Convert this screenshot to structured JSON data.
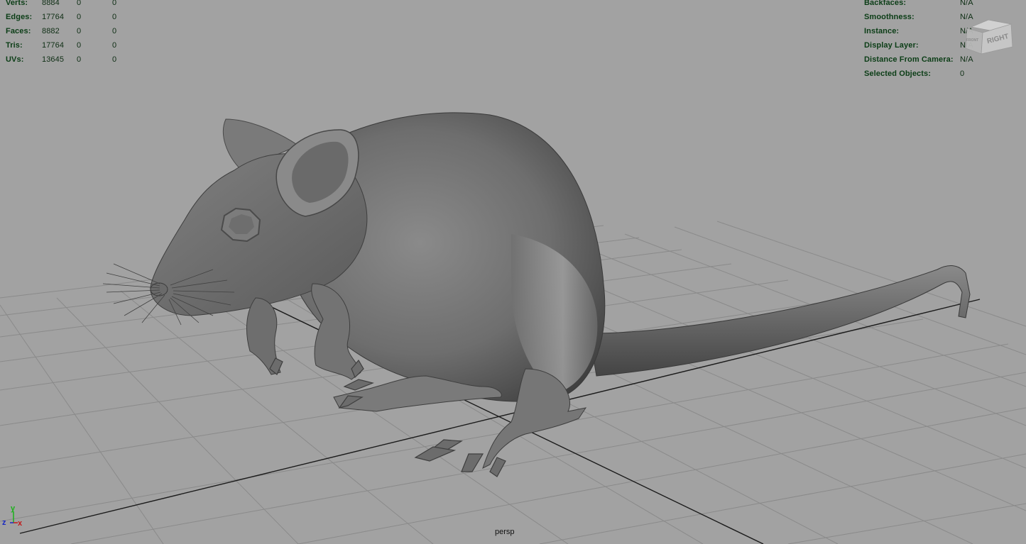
{
  "viewport": {
    "camera": "persp",
    "background_color": "#a2a2a2",
    "hud_text_color": "#0b3d16"
  },
  "poly_count": {
    "rows": [
      {
        "label": "Verts:",
        "v1": "8884",
        "v2": "0",
        "v3": "0"
      },
      {
        "label": "Edges:",
        "v1": "17764",
        "v2": "0",
        "v3": "0"
      },
      {
        "label": "Faces:",
        "v1": "8882",
        "v2": "0",
        "v3": "0"
      },
      {
        "label": "Tris:",
        "v1": "17764",
        "v2": "0",
        "v3": "0"
      },
      {
        "label": "UVs:",
        "v1": "13645",
        "v2": "0",
        "v3": "0"
      }
    ]
  },
  "object_details": {
    "rows": [
      {
        "label": "Backfaces:",
        "value": "N/A"
      },
      {
        "label": "Smoothness:",
        "value": "N/A"
      },
      {
        "label": "Instance:",
        "value": "N/A"
      },
      {
        "label": "Display Layer:",
        "value": "N/A"
      },
      {
        "label": "Distance From Camera:",
        "value": "N/A"
      },
      {
        "label": "Selected Objects:",
        "value": "0"
      }
    ]
  },
  "viewcube": {
    "face_right": "RIGHT",
    "face_front": "FRONT",
    "icon": "view-cube-icon"
  },
  "axis_gizmo": {
    "y": "y",
    "z": "z",
    "x": "x",
    "icon": "axis-triad-icon"
  }
}
